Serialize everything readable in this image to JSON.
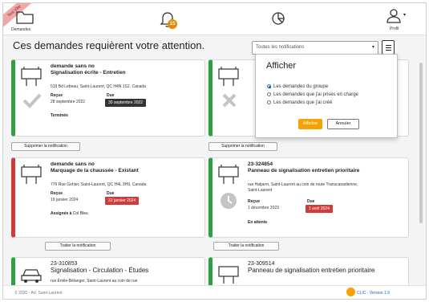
{
  "topbar": {
    "ribbon_label": "Test Ville",
    "demandes_label": "Demandes",
    "notif_count": "15",
    "profil_label": "Profil",
    "profil_caret": "▾"
  },
  "main": {
    "title": "Ces demandes requièrent votre attention.",
    "filter": {
      "selected": "Toutes les notifications",
      "caret": "▾"
    }
  },
  "popup": {
    "title": "Afficher",
    "options": [
      {
        "label": "Les demandes du groupe",
        "checked": true
      },
      {
        "label": "Les demandes que j'ai prises en charge",
        "checked": false
      },
      {
        "label": "Les demandes que j'ai créé",
        "checked": false
      }
    ],
    "apply_label": "Afficher",
    "cancel_label": "Annuler"
  },
  "cards": [
    {
      "title1": "demande sans no",
      "title2": "Signalisation écrite - Entretien",
      "address": "519 Bd Lebeau, Saint-Laurent, QC H4N 1S2, Canada",
      "recue_label": "Reçue",
      "recue_date": "28 septembre 2022",
      "due_label": "Due",
      "due_date": "30 septembre 2022",
      "status": "Terminée",
      "action": "Supprimer la notification"
    },
    {
      "action": "Supprimer la notification"
    },
    {
      "title1": "demande sans no",
      "title2": "Marquage de la chaussée - Existant",
      "address": "776 Rue Gohier, Saint-Laurent, QC H4L 3H9, Canada",
      "recue_label": "Reçue",
      "recue_date": "19 janvier 2024",
      "due_label": "Due",
      "due_date": "22 janvier 2024",
      "status_label": "Assignée à",
      "status_value": "Col Bleu",
      "action": "Traiter la notification"
    },
    {
      "title1": "23-324854",
      "title2": "Panneau de signalisation entretien prioritaire",
      "address": "rue Halpern, Saint-Laurent au coin de route Transcanadienne, Saint-Laurent",
      "recue_label": "Reçue",
      "recue_date": "1 décembre 2023",
      "due_label": "Due",
      "due_date": "1 avril 2024",
      "status": "En attente",
      "action": "Traiter la notification"
    },
    {
      "title1": "23-310853",
      "title2": "Signalisation - Circulation - Études",
      "address": "rue Émile-Bélanger, Saint-Laurent au coin de rue"
    },
    {
      "title1": "23-309514",
      "title2": "Panneau de signalisation entretien prioritaire"
    }
  ],
  "footer": {
    "copyright": "© 2020 - Arr. Saint-Laurent",
    "version": "CLIC - Version 1.9"
  },
  "colors": {
    "accent": "#f5a300",
    "green": "#2ea043",
    "red": "#d03b3b"
  }
}
